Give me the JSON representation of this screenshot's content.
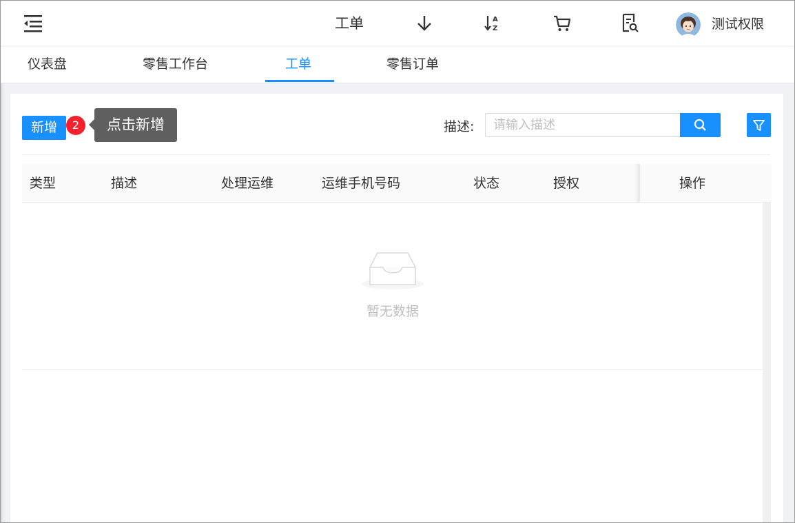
{
  "header": {
    "current_page": "工单",
    "icons": [
      "menu-fold-icon",
      "arrow-down-icon",
      "sort-az-icon",
      "cart-icon",
      "document-search-icon"
    ],
    "username": "测试权限"
  },
  "tabs": [
    {
      "label": "仪表盘",
      "active": false
    },
    {
      "label": "零售工作台",
      "active": false
    },
    {
      "label": "工单",
      "active": true
    },
    {
      "label": "零售订单",
      "active": false
    }
  ],
  "toolbar": {
    "add_label": "新增",
    "step_number": "2",
    "tooltip_text": "点击新增",
    "search_label": "描述:",
    "search_placeholder": "请输入描述"
  },
  "table": {
    "columns": [
      "类型",
      "描述",
      "处理运维",
      "运维手机号码",
      "状态",
      "授权",
      "操作"
    ],
    "empty_text": "暂无数据"
  },
  "colors": {
    "primary": "#1890ff",
    "badge": "#f5222d",
    "tooltip_bg": "#5f5f5f"
  }
}
